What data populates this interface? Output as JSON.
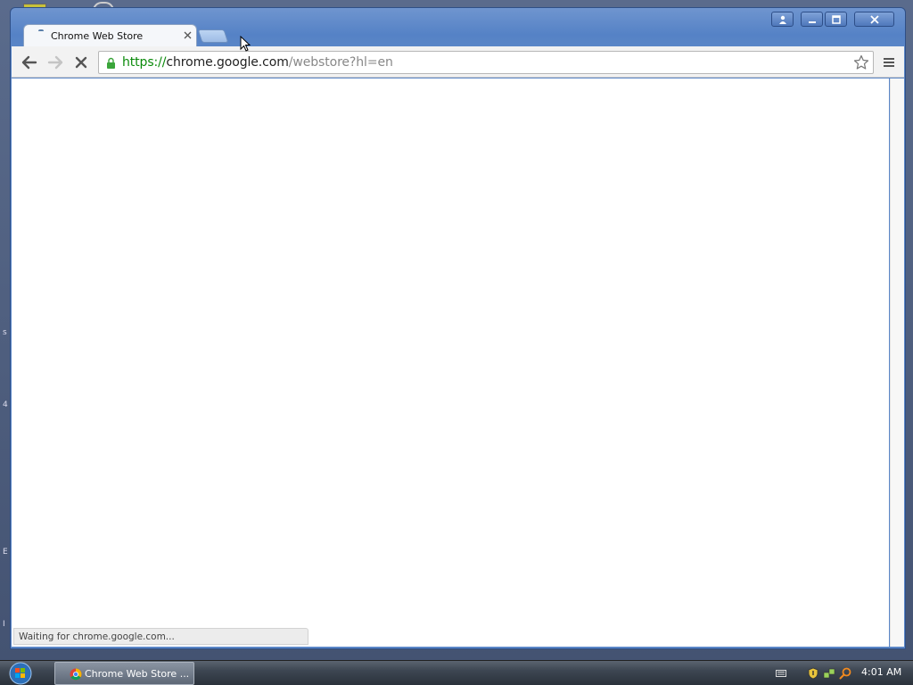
{
  "browser": {
    "tab": {
      "title": "Chrome Web Store",
      "close_symbol": "×"
    },
    "url": {
      "scheme": "https",
      "separator": "://",
      "host": "chrome.google.com",
      "path": "/webstore?hl=en"
    },
    "status": "Waiting for chrome.google.com..."
  },
  "taskbar": {
    "task_label": "Chrome Web Store ...",
    "clock": "4:01 AM"
  },
  "colors": {
    "url_green": "#0a8a0a",
    "window_frame": "#5582c6",
    "taskbar": "#2b323b"
  },
  "icons": [
    "back-icon",
    "forward-icon",
    "stop-icon",
    "lock-icon",
    "star-icon",
    "menu-icon",
    "profile-icon",
    "minimize-icon",
    "maximize-icon",
    "close-icon",
    "start-orb-icon",
    "chrome-icon",
    "keyboard-icon",
    "shield-icon",
    "network-icon",
    "search-icon",
    "cursor-icon"
  ]
}
